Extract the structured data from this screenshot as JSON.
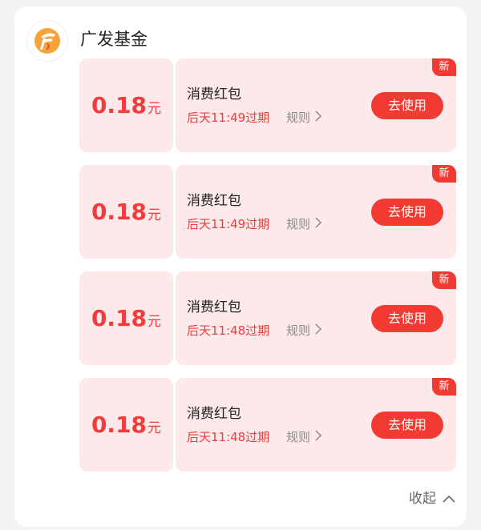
{
  "header": {
    "brand_name": "广发基金",
    "logo_icon": "gf-fund-logo-icon"
  },
  "colors": {
    "accent": "#f03a32",
    "coupon_bg": "#fde8ea",
    "expire_text": "#f03c3c"
  },
  "coupons": [
    {
      "amount": "0.18",
      "unit": "元",
      "title": "消费红包",
      "expire": "后天11:49过期",
      "rule_label": "规则",
      "button_label": "去使用",
      "badge": "新"
    },
    {
      "amount": "0.18",
      "unit": "元",
      "title": "消费红包",
      "expire": "后天11:49过期",
      "rule_label": "规则",
      "button_label": "去使用",
      "badge": "新"
    },
    {
      "amount": "0.18",
      "unit": "元",
      "title": "消费红包",
      "expire": "后天11:48过期",
      "rule_label": "规则",
      "button_label": "去使用",
      "badge": "新"
    },
    {
      "amount": "0.18",
      "unit": "元",
      "title": "消费红包",
      "expire": "后天11:48过期",
      "rule_label": "规则",
      "button_label": "去使用",
      "badge": "新"
    }
  ],
  "footer": {
    "collapse_label": "收起"
  }
}
